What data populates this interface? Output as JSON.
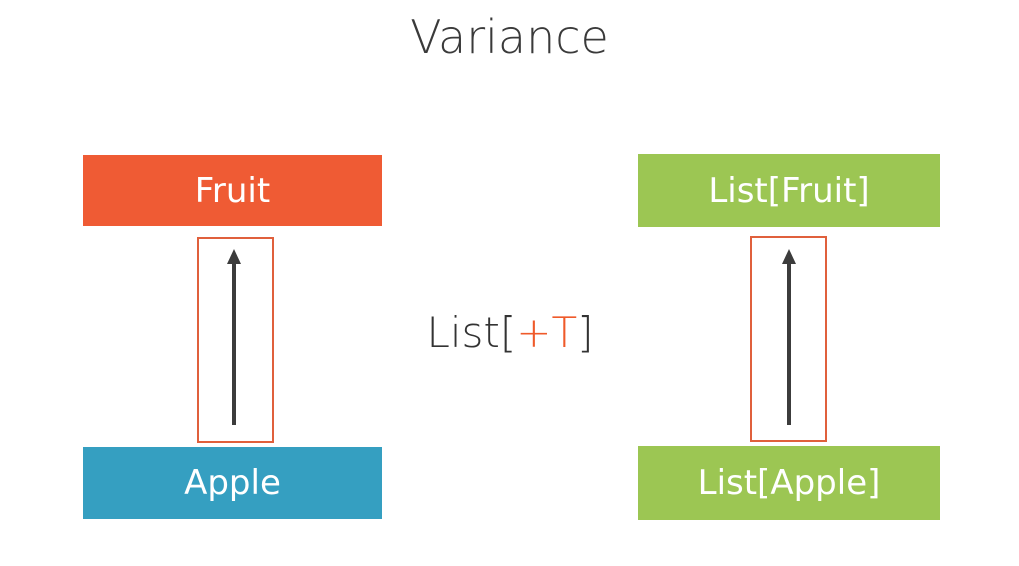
{
  "title": "Variance",
  "colors": {
    "fruit": "#ef5b34",
    "apple": "#359fc1",
    "list": "#9cc653",
    "frame": "#e0603c",
    "arrow": "#3c3c3c",
    "accent": "#ef5a2a"
  },
  "left": {
    "top_label": "Fruit",
    "bottom_label": "Apple"
  },
  "right": {
    "top_label": "List[Fruit]",
    "bottom_label": "List[Apple]"
  },
  "middle": {
    "prefix": "List[",
    "accent": "+T",
    "suffix": "]"
  }
}
